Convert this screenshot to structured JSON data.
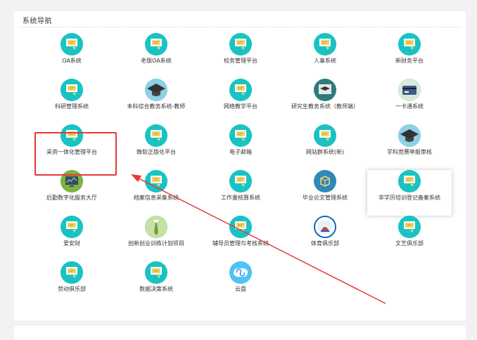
{
  "nav": {
    "title": "系统导航",
    "items": [
      {
        "label": "OA系统",
        "icon": "document-icon"
      },
      {
        "label": "老版OA系统",
        "icon": "document-icon"
      },
      {
        "label": "校务管理平台",
        "icon": "document-icon"
      },
      {
        "label": "人事系统",
        "icon": "document-icon"
      },
      {
        "label": "新财务平台",
        "icon": "document-icon"
      },
      {
        "label": "科研管理系统",
        "icon": "document-icon"
      },
      {
        "label": "本科综合教务系统-教师",
        "icon": "graduation-cap-icon"
      },
      {
        "label": "网络教学平台",
        "icon": "document-icon"
      },
      {
        "label": "研究生教务系统（教师端）",
        "icon": "graduation-cap-board-icon"
      },
      {
        "label": "一卡通系统",
        "icon": "card-icon"
      },
      {
        "label": "采资一体化管理平台",
        "icon": "document-icon"
      },
      {
        "label": "微软正版化平台",
        "icon": "document-icon"
      },
      {
        "label": "电子邮箱",
        "icon": "document-icon"
      },
      {
        "label": "网站群系统(新)",
        "icon": "document-icon"
      },
      {
        "label": "学科竞赛申报审核",
        "icon": "graduation-cap-icon"
      },
      {
        "label": "后勤数字化服务大厅",
        "icon": "dashboard-icon"
      },
      {
        "label": "档案信息采集系统",
        "icon": "document-icon"
      },
      {
        "label": "工作量核算系统",
        "icon": "document-icon"
      },
      {
        "label": "毕业论文管理系统",
        "icon": "cube-icon"
      },
      {
        "label": "非学历培训登记备案系统",
        "icon": "document-icon"
      },
      {
        "label": "爱安财",
        "icon": "document-icon"
      },
      {
        "label": "创新创业训练计划项目",
        "icon": "tie-icon"
      },
      {
        "label": "辅导员管理与考核系统",
        "icon": "document-icon"
      },
      {
        "label": "体育俱乐部",
        "icon": "sports-emblem-icon"
      },
      {
        "label": "文艺俱乐部",
        "icon": "document-icon"
      },
      {
        "label": "劳动俱乐部",
        "icon": "document-icon"
      },
      {
        "label": "数据决策系统",
        "icon": "document-icon"
      },
      {
        "label": "云盘",
        "icon": "cloud-icon"
      }
    ]
  },
  "colors": {
    "icon_bg": "#19c3c3",
    "doc_fill": "#f5d66b",
    "annotation": "#e53935"
  }
}
